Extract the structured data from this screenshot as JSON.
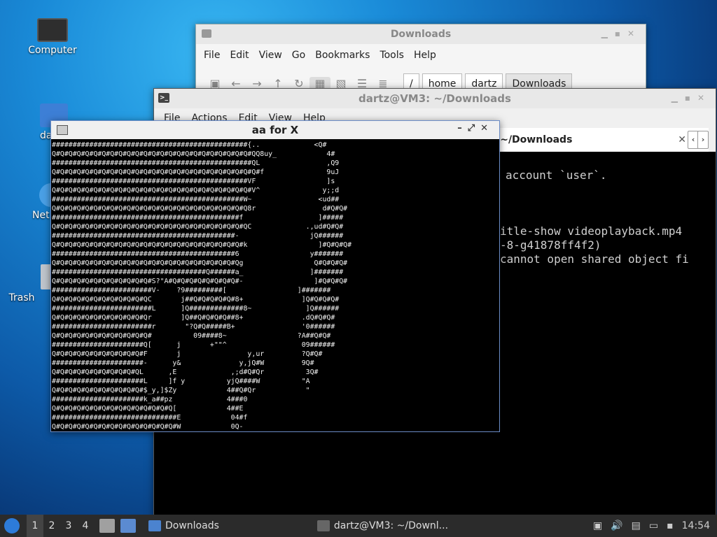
{
  "desktop": {
    "icons": [
      {
        "label": "Computer",
        "icon": "monitor-icon"
      },
      {
        "label": "da",
        "icon": "home-folder-icon"
      },
      {
        "label": "Net",
        "icon": "network-icon"
      },
      {
        "label": "Trash",
        "icon": "trash-icon"
      }
    ]
  },
  "file_manager": {
    "title": "Downloads",
    "menu": [
      "File",
      "Edit",
      "View",
      "Go",
      "Bookmarks",
      "Tools",
      "Help"
    ],
    "path": [
      "/",
      "home",
      "dartz",
      "Downloads"
    ]
  },
  "terminal": {
    "title": "dartz@VM3: ~/Downloads",
    "menu": [
      "File",
      "Actions",
      "Edit",
      "View",
      "Help"
    ],
    "tab_label": "3: ~/Downloads",
    "lines": [
      "account `user`.",
      "itle-show videoplayback.mp4",
      "-8-g41878ff4f2)",
      "cannot open shared object fi"
    ]
  },
  "aa_window": {
    "title": "aa for X",
    "ascii": "###############################################{..             <Q#\nQ#Q#Q#Q#Q#Q#Q#Q#Q#Q#Q#Q#Q#Q#Q#Q#Q#Q#Q#Q#Q#Q#Q#Q#QQ8uy_            4#\n################################################QL                ,Q9\nQ#Q#Q#Q#Q#Q#Q#Q#Q#Q#Q#Q#Q#Q#Q#Q#Q#Q#Q#Q#Q#Q#Q#Q#Q#f               9uJ\n###############################################VF                 ]s\nQ#Q#Q#Q#Q#Q#Q#Q#Q#Q#Q#Q#Q#Q#Q#Q#Q#Q#Q#Q#Q#Q#Q#Q#V^               y;;d\n##############################################W~                <ud##\nQ#Q#Q#Q#Q#Q#Q#Q#Q#Q#Q#Q#Q#Q#Q#Q#Q#Q#Q#Q#Q#Q#Q#Q8r                d#Q#Q#\n#############################################f                  ]#####\nQ#Q#Q#Q#Q#Q#Q#Q#Q#Q#Q#Q#Q#Q#Q#Q#Q#Q#Q#Q#Q#Q#Q#QC             .,ud#Q#Q#\n############################################-                 jQ######\nQ#Q#Q#Q#Q#Q#Q#Q#Q#Q#Q#Q#Q#Q#Q#Q#Q#Q#Q#Q#Q#Q#Q#k                 ]#Q#Q#Q#\n############################################6                 y#######\nQ#Q#Q#Q#Q#Q#Q#Q#Q#Q#Q#Q#Q#Q#Q#Q#Q#Q#Q#Q#Q#Q#Qg                 Q#Q#Q#Q#\n#####################################Q######a_                ]#######\nQ#Q#Q#Q#Q#Q#Q#Q#Q#Q#Q#Q#S?\"A#Q#Q#Q#Q#Q#Q#Q#Q#-                 ]#Q#Q#Q#\n########################V-    ?9#########[                 ]#######\nQ#Q#Q#Q#Q#Q#Q#Q#Q#Q#Q#QC       j##Q#Q#Q#Q#Q#8+              ]Q#Q#Q#Q#\n########################L      ]Q#############8~             ]Q######\nQ#Q#Q#Q#Q#Q#Q#Q#Q#Q#Q#Qr       ]Q##Q#Q#Q#Q##8+              .dQ#Q#Q#\n########################r       \"?Q#Q#####B+                '0######\nQ#Q#Q#Q#Q#Q#Q#Q#Q#Q#Q#Q#          09####8~                 ?A##Q#Q#\n######################Q[      j       +\"\"^                  09######\nQ#Q#Q#Q#Q#Q#Q#Q#Q#Q#Q#F       j                y,ur         ?Q#Q#\n######################-      y&              y,jQ#W         9Q#\nQ#Q#Q#Q#Q#Q#Q#Q#Q#Q#QL      ,E             ,;d#Q#Qr          3Q#\n######################L     ]f y          yjQ####W          \"A\nQ#Q#Q#Q#Q#Q#Q#Q#Q#Q#Q#$_y,]$Zy            4##Q#Qr            \"\n######################k_a##pz             4###0\nQ#Q#Q#Q#Q#Q#Q#Q#Q#Q#Q#Q#Q#Q#Q[            4##E\n##############################E            04#f\nQ#Q#Q#Q#Q#Q#Q#Q#Q#Q#Q#Q#Q#Q#Q#W            0Q-"
  },
  "taskbar": {
    "workspaces": [
      "1",
      "2",
      "3",
      "4"
    ],
    "tasks": [
      {
        "label": "Downloads",
        "icon": "folder-icon"
      },
      {
        "label": "dartz@VM3: ~/Downl...",
        "icon": "terminal-icon"
      }
    ],
    "clock": "14:54"
  }
}
